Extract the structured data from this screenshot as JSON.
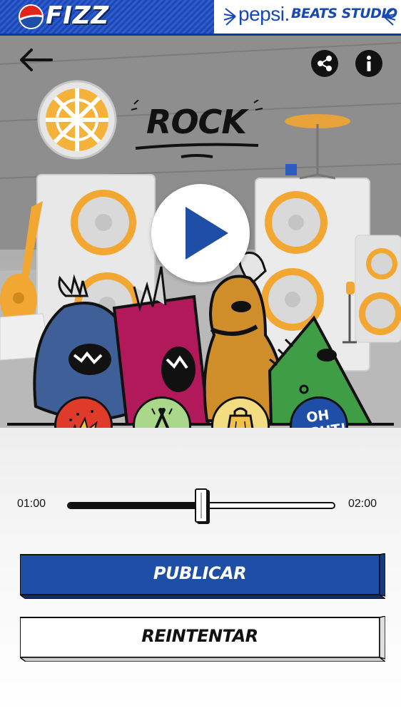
{
  "header": {
    "left_logo_text": "FIZZ",
    "right_brand_text": "pepsi.",
    "right_product_text": "BEATS STUDIO"
  },
  "scene": {
    "genre_title": "ROCK",
    "genre_title_aria": "ROCK"
  },
  "sound_pads": [
    {
      "name": "explosion"
    },
    {
      "name": "drumsticks"
    },
    {
      "name": "cowbell"
    },
    {
      "name": "oh-right",
      "line1": "OH",
      "line2": "RIGHT!"
    }
  ],
  "timeline": {
    "start_time": "01:00",
    "end_time": "02:00",
    "position_fraction": 0.5
  },
  "actions": {
    "publish_label": "PUBLICAR",
    "retry_label": "REINTENTAR"
  },
  "colors": {
    "brand_blue": "#1f4ea6",
    "header_blue": "#1c47b4",
    "pad_red": "#e03a2a",
    "pad_green": "#a9d88a",
    "pad_yellow": "#f3dc82",
    "pad_blue": "#1f4ea6",
    "play_icon": "#1f4ea6"
  },
  "icons": {
    "back": "arrow-left-icon",
    "share": "share-icon",
    "info": "info-icon",
    "play": "play-icon"
  }
}
